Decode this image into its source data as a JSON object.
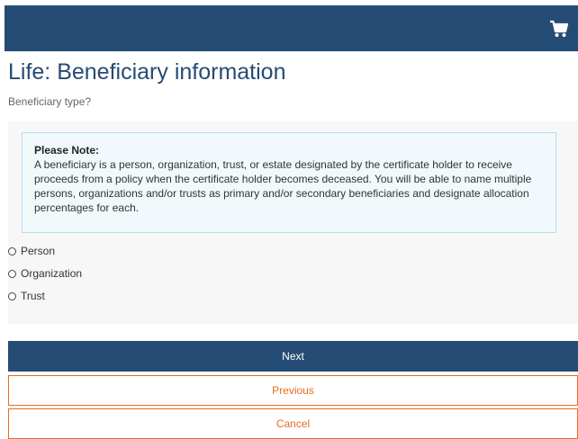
{
  "header": {
    "cart_icon": "shopping-cart-icon",
    "background_color": "#254c75"
  },
  "page": {
    "title": "Life: Beneficiary information",
    "subtitle": "Beneficiary type?"
  },
  "note": {
    "heading": "Please Note:",
    "body": "A beneficiary is a person, organization, trust, or estate designated by the certificate holder to receive proceeds from a policy when the certificate holder becomes deceased. You will be able to name multiple persons, organizations and/or trusts as primary and/or secondary beneficiaries and designate allocation percentages for each."
  },
  "beneficiary_type": {
    "selected": null,
    "options": [
      {
        "label": "Person"
      },
      {
        "label": "Organization"
      },
      {
        "label": "Trust"
      }
    ]
  },
  "actions": {
    "next_label": "Next",
    "previous_label": "Previous",
    "cancel_label": "Cancel"
  },
  "colors": {
    "primary": "#254c75",
    "accent": "#e86b1f",
    "note_background": "#f2f9fd",
    "note_border": "#b8dcef"
  }
}
